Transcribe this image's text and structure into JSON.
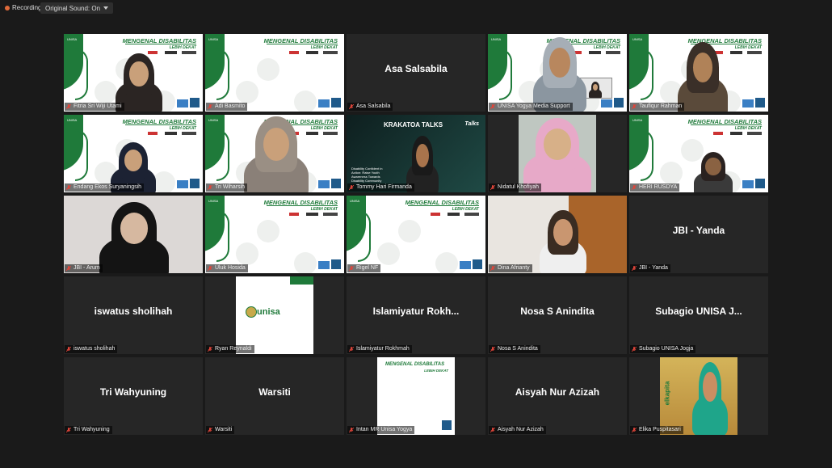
{
  "toolbar": {
    "recording_label": "Recording",
    "sound_label": "Original Sound: On"
  },
  "slide": {
    "title": "MENGENAL DISABILITAS",
    "subtitle": "LEBIH DEKAT",
    "logo_text": "UNISA"
  },
  "krakatoa": {
    "title": "KRAKATOA TALKS",
    "text": "Disability Confident in Action: Raise Youth Awareness Towards Disability Community",
    "corner": "Talks"
  },
  "unisa_card": {
    "logo": "unisa"
  },
  "elika_card": {
    "handle": "elkapita"
  },
  "participants": [
    {
      "name": "Fitria Sri Wiji Utami",
      "center": ""
    },
    {
      "name": "Adi Basmito",
      "center": ""
    },
    {
      "name": "Asa Salsabila",
      "center": "Asa Salsabila"
    },
    {
      "name": "UNISA Yogya Media Support",
      "center": ""
    },
    {
      "name": "Taufiqur Rahman",
      "center": ""
    },
    {
      "name": "Endang Ekos Suryaningsih",
      "center": ""
    },
    {
      "name": "Tri Wiharsih",
      "center": ""
    },
    {
      "name": "Tommy Hari Firmanda",
      "center": ""
    },
    {
      "name": "Nidatul Khofiyah",
      "center": ""
    },
    {
      "name": "HERI RUSDYA",
      "center": ""
    },
    {
      "name": "JBI - Arum",
      "center": ""
    },
    {
      "name": "Uluk Hosida",
      "center": ""
    },
    {
      "name": "Rigel NF",
      "center": ""
    },
    {
      "name": "Dina Afrianty",
      "center": ""
    },
    {
      "name": "JBI - Yanda",
      "center": "JBI - Yanda"
    },
    {
      "name": "iswatus sholihah",
      "center": "iswatus sholihah"
    },
    {
      "name": "Ryan Reynaldi",
      "center": ""
    },
    {
      "name": "Islamiyatur Rokhmah",
      "center": "Islamiyatur  Rokh..."
    },
    {
      "name": "Nosa S Anindita",
      "center": "Nosa S Anindita"
    },
    {
      "name": "Subagio UNISA Jogja",
      "center": "Subagio UNISA J..."
    },
    {
      "name": "Tri Wahyuning",
      "center": "Tri Wahyuning"
    },
    {
      "name": "Warsiti",
      "center": "Warsiti"
    },
    {
      "name": "Intan MR Unisa Yogya",
      "center": ""
    },
    {
      "name": "Aisyah Nur Azizah",
      "center": "Aisyah Nur Azizah"
    },
    {
      "name": "Elika Puspitasari",
      "center": ""
    }
  ],
  "colors": {
    "background": "#1a1a1a",
    "tile": "#262626",
    "unisa_green": "#1f7a3a",
    "active_outline": "#b8d36a",
    "mic_muted": "#e0453a"
  }
}
